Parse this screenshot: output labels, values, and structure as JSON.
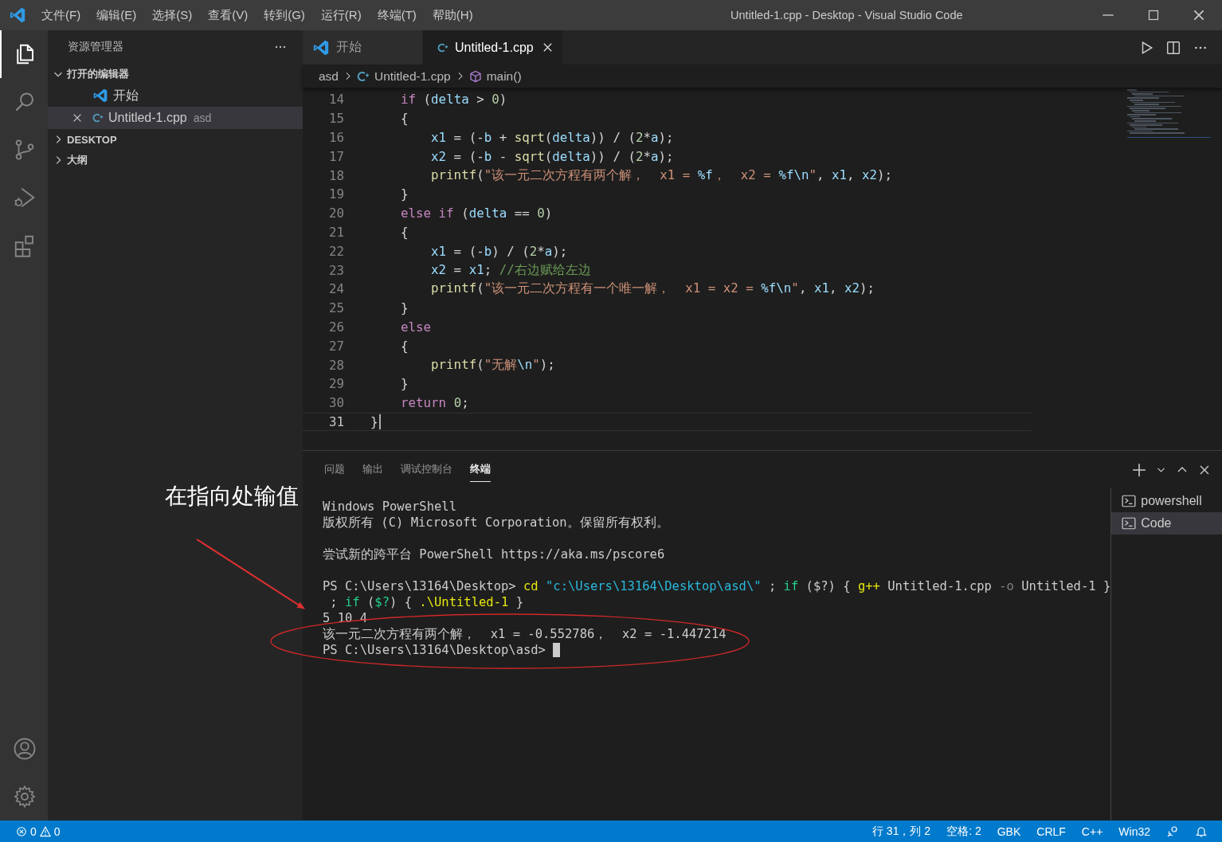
{
  "window": {
    "title": "Untitled-1.cpp - Desktop - Visual Studio Code"
  },
  "menu": [
    "文件(F)",
    "编辑(E)",
    "选择(S)",
    "查看(V)",
    "转到(G)",
    "运行(R)",
    "终端(T)",
    "帮助(H)"
  ],
  "activity_bar": [
    {
      "kind": "explorer",
      "selected": true
    },
    {
      "kind": "search",
      "selected": false
    },
    {
      "kind": "scm",
      "selected": false
    },
    {
      "kind": "debug",
      "selected": false
    },
    {
      "kind": "extensions",
      "selected": false
    }
  ],
  "activity_bottom": [
    {
      "kind": "account"
    },
    {
      "kind": "settings"
    }
  ],
  "sidebar": {
    "title": "资源管理器",
    "sections": [
      {
        "title": "打开的编辑器",
        "expanded": true,
        "items": [
          {
            "label": "开始",
            "kind": "welcome",
            "selected": false
          },
          {
            "label": "Untitled-1.cpp",
            "description": "asd",
            "kind": "cpp",
            "selected": true
          }
        ]
      },
      {
        "title": "DESKTOP",
        "expanded": false
      },
      {
        "title": "大纲",
        "expanded": false
      }
    ]
  },
  "tabs": [
    {
      "label": "开始",
      "kind": "welcome",
      "selected": false
    },
    {
      "label": "Untitled-1.cpp",
      "kind": "cpp",
      "selected": true
    }
  ],
  "breadcrumbs": [
    {
      "label": "asd",
      "kind": "folder"
    },
    {
      "label": "Untitled-1.cpp",
      "kind": "cpp"
    },
    {
      "label": "main()",
      "kind": "function"
    }
  ],
  "code_lines": [
    {
      "number": "14",
      "current": false,
      "tokens": [
        {
          "kind": "kw",
          "text": "    if"
        },
        {
          "kind": "op",
          "text": " ("
        },
        {
          "kind": "var",
          "text": "delta"
        },
        {
          "kind": "op",
          "text": " > "
        },
        {
          "kind": "num",
          "text": "0"
        },
        {
          "kind": "op",
          "text": ")"
        }
      ]
    },
    {
      "number": "15",
      "current": false,
      "tokens": [
        {
          "kind": "op",
          "text": "    {"
        }
      ]
    },
    {
      "number": "16",
      "current": false,
      "tokens": [
        {
          "kind": "var",
          "text": "        x1"
        },
        {
          "kind": "op",
          "text": " = (-"
        },
        {
          "kind": "var",
          "text": "b"
        },
        {
          "kind": "op",
          "text": " + "
        },
        {
          "kind": "fn",
          "text": "sqrt"
        },
        {
          "kind": "op",
          "text": "("
        },
        {
          "kind": "var",
          "text": "delta"
        },
        {
          "kind": "op",
          "text": ")) / ("
        },
        {
          "kind": "num",
          "text": "2"
        },
        {
          "kind": "op",
          "text": "*"
        },
        {
          "kind": "var",
          "text": "a"
        },
        {
          "kind": "op",
          "text": ");"
        }
      ]
    },
    {
      "number": "17",
      "current": false,
      "tokens": [
        {
          "kind": "var",
          "text": "        x2"
        },
        {
          "kind": "op",
          "text": " = (-"
        },
        {
          "kind": "var",
          "text": "b"
        },
        {
          "kind": "op",
          "text": " - "
        },
        {
          "kind": "fn",
          "text": "sqrt"
        },
        {
          "kind": "op",
          "text": "("
        },
        {
          "kind": "var",
          "text": "delta"
        },
        {
          "kind": "op",
          "text": ")) / ("
        },
        {
          "kind": "num",
          "text": "2"
        },
        {
          "kind": "op",
          "text": "*"
        },
        {
          "kind": "var",
          "text": "a"
        },
        {
          "kind": "op",
          "text": ");"
        }
      ]
    },
    {
      "number": "18",
      "current": false,
      "tokens": [
        {
          "kind": "fn",
          "text": "        printf"
        },
        {
          "kind": "op",
          "text": "("
        },
        {
          "kind": "str",
          "text": "\"该一元二次方程有两个解，  x1 = "
        },
        {
          "kind": "fmt",
          "text": "%f"
        },
        {
          "kind": "str",
          "text": "，  x2 = "
        },
        {
          "kind": "fmt",
          "text": "%f\\n"
        },
        {
          "kind": "str",
          "text": "\""
        },
        {
          "kind": "op",
          "text": ", "
        },
        {
          "kind": "var",
          "text": "x1"
        },
        {
          "kind": "op",
          "text": ", "
        },
        {
          "kind": "var",
          "text": "x2"
        },
        {
          "kind": "op",
          "text": ");"
        }
      ]
    },
    {
      "number": "19",
      "current": false,
      "tokens": [
        {
          "kind": "op",
          "text": "    }"
        }
      ]
    },
    {
      "number": "20",
      "current": false,
      "tokens": [
        {
          "kind": "kw",
          "text": "    else if"
        },
        {
          "kind": "op",
          "text": " ("
        },
        {
          "kind": "var",
          "text": "delta"
        },
        {
          "kind": "op",
          "text": " == "
        },
        {
          "kind": "num",
          "text": "0"
        },
        {
          "kind": "op",
          "text": ")"
        }
      ]
    },
    {
      "number": "21",
      "current": false,
      "tokens": [
        {
          "kind": "op",
          "text": "    {"
        }
      ]
    },
    {
      "number": "22",
      "current": false,
      "tokens": [
        {
          "kind": "var",
          "text": "        x1"
        },
        {
          "kind": "op",
          "text": " = (-"
        },
        {
          "kind": "var",
          "text": "b"
        },
        {
          "kind": "op",
          "text": ") / ("
        },
        {
          "kind": "num",
          "text": "2"
        },
        {
          "kind": "op",
          "text": "*"
        },
        {
          "kind": "var",
          "text": "a"
        },
        {
          "kind": "op",
          "text": ");"
        }
      ]
    },
    {
      "number": "23",
      "current": false,
      "tokens": [
        {
          "kind": "var",
          "text": "        x2"
        },
        {
          "kind": "op",
          "text": " = "
        },
        {
          "kind": "var",
          "text": "x1"
        },
        {
          "kind": "op",
          "text": "; "
        },
        {
          "kind": "cmt",
          "text": "//右边赋给左边"
        }
      ]
    },
    {
      "number": "24",
      "current": false,
      "tokens": [
        {
          "kind": "fn",
          "text": "        printf"
        },
        {
          "kind": "op",
          "text": "("
        },
        {
          "kind": "str",
          "text": "\"该一元二次方程有一个唯一解，  x1 = x2 = "
        },
        {
          "kind": "fmt",
          "text": "%f\\n"
        },
        {
          "kind": "str",
          "text": "\""
        },
        {
          "kind": "op",
          "text": ", "
        },
        {
          "kind": "var",
          "text": "x1"
        },
        {
          "kind": "op",
          "text": ", "
        },
        {
          "kind": "var",
          "text": "x2"
        },
        {
          "kind": "op",
          "text": ");"
        }
      ]
    },
    {
      "number": "25",
      "current": false,
      "tokens": [
        {
          "kind": "op",
          "text": "    }"
        }
      ]
    },
    {
      "number": "26",
      "current": false,
      "tokens": [
        {
          "kind": "kw",
          "text": "    else"
        }
      ]
    },
    {
      "number": "27",
      "current": false,
      "tokens": [
        {
          "kind": "op",
          "text": "    {"
        }
      ]
    },
    {
      "number": "28",
      "current": false,
      "tokens": [
        {
          "kind": "fn",
          "text": "        printf"
        },
        {
          "kind": "op",
          "text": "("
        },
        {
          "kind": "str",
          "text": "\"无解"
        },
        {
          "kind": "fmt",
          "text": "\\n"
        },
        {
          "kind": "str",
          "text": "\""
        },
        {
          "kind": "op",
          "text": ");"
        }
      ]
    },
    {
      "number": "29",
      "current": false,
      "tokens": [
        {
          "kind": "op",
          "text": "    }"
        }
      ]
    },
    {
      "number": "30",
      "current": false,
      "tokens": [
        {
          "kind": "kw",
          "text": "    return "
        },
        {
          "kind": "num",
          "text": "0"
        },
        {
          "kind": "op",
          "text": ";"
        }
      ]
    },
    {
      "number": "31",
      "current": true,
      "tokens": [
        {
          "kind": "op",
          "text": "}"
        }
      ]
    }
  ],
  "panel_tabs": [
    {
      "label": "问题",
      "selected": false
    },
    {
      "label": "输出",
      "selected": false
    },
    {
      "label": "调试控制台",
      "selected": false
    },
    {
      "label": "终端",
      "selected": true
    }
  ],
  "terminal": {
    "cursor": true,
    "blocks": [
      [
        {
          "tokens": [
            {
              "kind": "plain",
              "text": "Windows PowerShell"
            }
          ]
        },
        {
          "tokens": [
            {
              "kind": "plain",
              "text": "版权所有 (C) Microsoft Corporation。保留所有权利。"
            }
          ]
        }
      ],
      [
        {
          "tokens": [
            {
              "kind": "plain",
              "text": "尝试新的跨平台 PowerShell https://aka.ms/pscore6"
            }
          ]
        }
      ],
      [
        {
          "tokens": [
            {
              "kind": "plain",
              "text": "PS C:\\Users\\13164\\Desktop> "
            },
            {
              "kind": "cmd",
              "text": "cd "
            },
            {
              "kind": "str",
              "text": "\"c:\\Users\\13164\\Desktop\\asd\\\""
            },
            {
              "kind": "plain",
              "text": " ; "
            },
            {
              "kind": "kw",
              "text": "if"
            },
            {
              "kind": "plain",
              "text": " ($?) { "
            },
            {
              "kind": "cmd",
              "text": "g++"
            },
            {
              "kind": "plain",
              "text": " Untitled-1.cpp "
            },
            {
              "kind": "dim",
              "text": "-o"
            },
            {
              "kind": "plain",
              "text": " Untitled-1 }"
            }
          ]
        },
        {
          "tokens": [
            {
              "kind": "plain",
              "text": " ; "
            },
            {
              "kind": "kw",
              "text": "if"
            },
            {
              "kind": "plain",
              "text": " ("
            },
            {
              "kind": "kw",
              "text": "$?"
            },
            {
              "kind": "plain",
              "text": ") { "
            },
            {
              "kind": "cmd",
              "text": ".\\Untitled-1"
            },
            {
              "kind": "plain",
              "text": " }"
            }
          ]
        },
        {
          "tokens": [
            {
              "kind": "plain",
              "text": "5 10 4"
            }
          ]
        },
        {
          "tokens": [
            {
              "kind": "plain",
              "text": "该一元二次方程有两个解，  x1 = -0.552786，  x2 = -1.447214"
            }
          ]
        },
        {
          "tokens": [
            {
              "kind": "plain",
              "text": "PS C:\\Users\\13164\\Desktop\\asd> "
            }
          ]
        }
      ]
    ]
  },
  "terminal_list": [
    {
      "label": "powershell",
      "selected": false
    },
    {
      "label": "Code",
      "selected": true
    }
  ],
  "annotation": {
    "text": "在指向处输值"
  },
  "status_bar": {
    "errors": "0",
    "warnings": "0",
    "items": [
      "行 31，列 2",
      "空格: 2",
      "GBK",
      "CRLF",
      "C++",
      "Win32"
    ]
  }
}
